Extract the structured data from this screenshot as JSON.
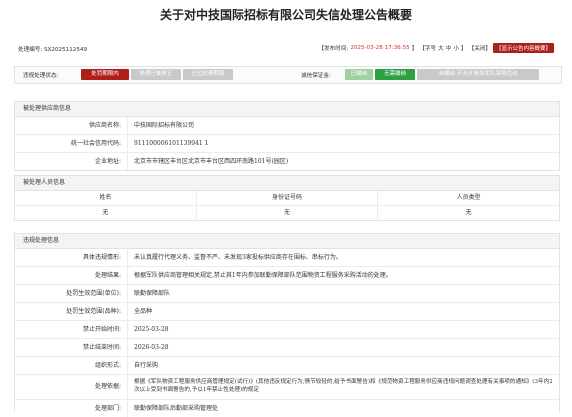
{
  "page_title": "关于对中技国际招标有限公司失信处理公告概要",
  "meta": {
    "code_label": "处理编号:",
    "code_value": "SX2025112549",
    "date_label": "【发布时间:",
    "date_value": "2025-03-28 17:36:55",
    "date_close": "】",
    "font_size_label": "【字号",
    "font_large": "大",
    "font_medium": "中",
    "font_small": "小",
    "font_close": "】",
    "close_link": "【关闭】",
    "flag_button": "【显示公告内容概要】"
  },
  "status": {
    "violation_label": "违规处理状态:",
    "buttons": [
      {
        "label": "处罚期限内",
        "style": "active-red"
      },
      {
        "label": "处理已被更正",
        "style": "grey"
      },
      {
        "label": "已过处理期限",
        "style": "grey"
      }
    ],
    "bond_label": "诚信保证金:",
    "bond_buttons": [
      {
        "label": "已缴纳",
        "style": "green-l"
      },
      {
        "label": "无需缴纳",
        "style": "green"
      },
      {
        "label": "未缴纳-不允许参加军队采购活动",
        "style": "grey"
      }
    ]
  },
  "supplier": {
    "section_title": "被处理供应商信息",
    "rows": [
      {
        "key": "供应商名称:",
        "value": "中技国际招标有限公司"
      },
      {
        "key": "统一社会信用代码:",
        "value": "911100006101139941 1"
      },
      {
        "key": "企业地址:",
        "value": "北京市市辖区丰台区北京市丰台区西四环南路101号(园区)"
      }
    ]
  },
  "persons": {
    "section_title": "被处理人员信息",
    "headers": [
      "姓名",
      "身份证号码",
      "人员类型"
    ],
    "row": [
      "无",
      "无",
      "无"
    ]
  },
  "violation": {
    "section_title": "违规处理信息",
    "rows": [
      {
        "key": "具体违规情形:",
        "value": "未认真履行代理义务、监督不严、未发现3家投标供应商存在围标、串标行为。"
      },
      {
        "key": "处理结果:",
        "value": "根据军队供应商管理相关规定,禁止其1年内参加联勤保障部队范围物资工程服务采购活动的处理。"
      },
      {
        "key": "处罚生效范围(单位):",
        "value": "联勤保障部队"
      },
      {
        "key": "处罚生效范围(品种):",
        "value": "全品种"
      },
      {
        "key": "禁止开始时间:",
        "value": "2025-03-28"
      },
      {
        "key": "禁止结束时间:",
        "value": "2026-03-28"
      },
      {
        "key": "组织形式:",
        "value": "自行采购"
      },
      {
        "key": "处理依据:",
        "value": "根据《军队物资工程服务供应商管理规定(试行)》(其他违反规定行为,情节较轻的,给予书面警告)和《规范物资工程服务供应商违规问题调查处理有关事项的通知》(3年内2次以上受到书面警告的,予以1年禁止性处理)的规定"
      },
      {
        "key": "处理部门:",
        "value": "联勤保障部队后勤部采购管理处"
      }
    ]
  }
}
